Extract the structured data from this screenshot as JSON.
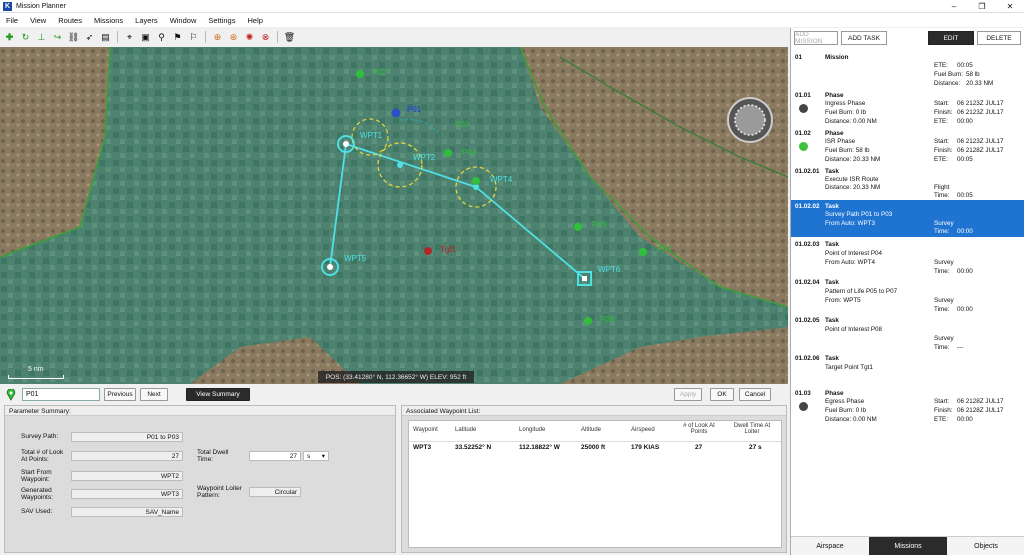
{
  "app": {
    "title": "Mission Planner"
  },
  "menu": [
    "File",
    "View",
    "Routes",
    "Missions",
    "Layers",
    "Window",
    "Settings",
    "Help"
  ],
  "map": {
    "labels": [
      "P01",
      "WPT1",
      "WPT2",
      "WPT3",
      "WPT4",
      "WPT5",
      "WPT6",
      "Tgt1",
      "P02",
      "P03",
      "P04",
      "P05",
      "P06",
      "P07",
      "P08"
    ],
    "pos": "POS: (33.41280° N, 112.36652° W) ELEV: 952 ft",
    "scale": "5 nm"
  },
  "bottom": {
    "field": "P01",
    "previous": "Previous",
    "next": "Next",
    "view_summary": "View Summary",
    "apply": "Apply",
    "ok": "OK",
    "cancel": "Cancel"
  },
  "params": {
    "title": "Parameter Summary:",
    "survey_path_label": "Survey Path:",
    "survey_path": "P01 to P03",
    "total_look_label": "Total # of Look At Points:",
    "total_look": "27",
    "total_dwell_label": "Total Dwell Time:",
    "total_dwell": "27",
    "dwell_unit": "s",
    "start_label": "Start From Waypoint:",
    "start": "WPT2",
    "generated_label": "Generated Waypoints:",
    "generated": "WPT3",
    "loiter_label": "Waypoint Loiter Pattern:",
    "loiter": "Circular",
    "sav_label": "SAV Used:",
    "sav": "SAV_Name"
  },
  "waypoints": {
    "title": "Associated Waypoint List:",
    "headers": [
      "Waypoint",
      "Latitude",
      "Longitude",
      "Altitude",
      "Airspeed",
      "# of Look At Points",
      "Dwell Time At Loiter"
    ],
    "rows": [
      [
        "WPT3",
        "33.52252° N",
        "112.18822° W",
        "25000 ft",
        "179 KIAS",
        "27",
        "27 s"
      ]
    ]
  },
  "right": {
    "add_mission": "ADD MISSION",
    "add_task": "ADD TASK",
    "edit": "EDIT",
    "delete": "DELETE",
    "mission": {
      "id": "01",
      "title": "Mission",
      "ete_l": "ETE:",
      "ete": "00:05",
      "fuel_l": "Fuel Burn:",
      "fuel": "58 lb",
      "dist_l": "Distance:",
      "dist": "20.33 NM"
    },
    "phase1": {
      "id": "01.01",
      "title": "Phase",
      "sub": "Ingress Phase",
      "fuel": "Fuel Burn: 0 lb",
      "dist": "Distance:   0.00 NM",
      "start": "Start:",
      "start_v": "06 2123Z JUL17",
      "finish": "Finish:",
      "finish_v": "06 2123Z JUL17",
      "ete": "ETE:",
      "ete_v": "00:00"
    },
    "phase2": {
      "id": "01.02",
      "title": "Phase",
      "sub": "ISR Phase",
      "fuel": "Fuel Burn: 58 lb",
      "dist": "Distance:   20.33 NM",
      "start": "Start:",
      "start_v": "06 2123Z JUL17",
      "finish": "Finish:",
      "finish_v": "06 2128Z JUL17",
      "ete": "ETE:",
      "ete_v": "00:05"
    },
    "t1": {
      "id": "01.02.01",
      "title": "Task",
      "sub": "Execute ISR Route",
      "sub2": "Distance:   20.33 NM",
      "k1": "Flight",
      "k2": "Time:",
      "v2": "00:05"
    },
    "t2": {
      "id": "01.02.02",
      "title": "Task",
      "sub": "Survey Path P01 to P03",
      "sub2": "From Auto: WPT3",
      "k1": "Survey",
      "k2": "Time:",
      "v2": "00:00"
    },
    "t3": {
      "id": "01.02.03",
      "title": "Task",
      "sub": "Point of Interest P04",
      "sub2": "From Auto: WPT4",
      "k1": "Survey",
      "k2": "Time:",
      "v2": "00:00"
    },
    "t4": {
      "id": "01.02.04",
      "title": "Task",
      "sub": "Pattern of Life P05 to P07",
      "sub2": "From: WPT5",
      "k1": "Survey",
      "k2": "Time:",
      "v2": "00:00"
    },
    "t5": {
      "id": "01.02.05",
      "title": "Task",
      "sub": "Point of Interest P08",
      "k1": "Survey",
      "k2": "Time:",
      "v2": "---"
    },
    "t6": {
      "id": "01.02.06",
      "title": "Task",
      "sub": "Target Point Tgt1"
    },
    "phase3": {
      "id": "01.03",
      "title": "Phase",
      "sub": "Egress Phase",
      "fuel": "Fuel Burn: 0 lb",
      "dist": "Distance:   0.00 NM",
      "start": "Start:",
      "start_v": "06 2128Z JUL17",
      "finish": "Finish:",
      "finish_v": "06 2128Z JUL17",
      "ete": "ETE:",
      "ete_v": "00:00"
    },
    "tabs": [
      "Airspace",
      "Missions",
      "Objects"
    ]
  }
}
